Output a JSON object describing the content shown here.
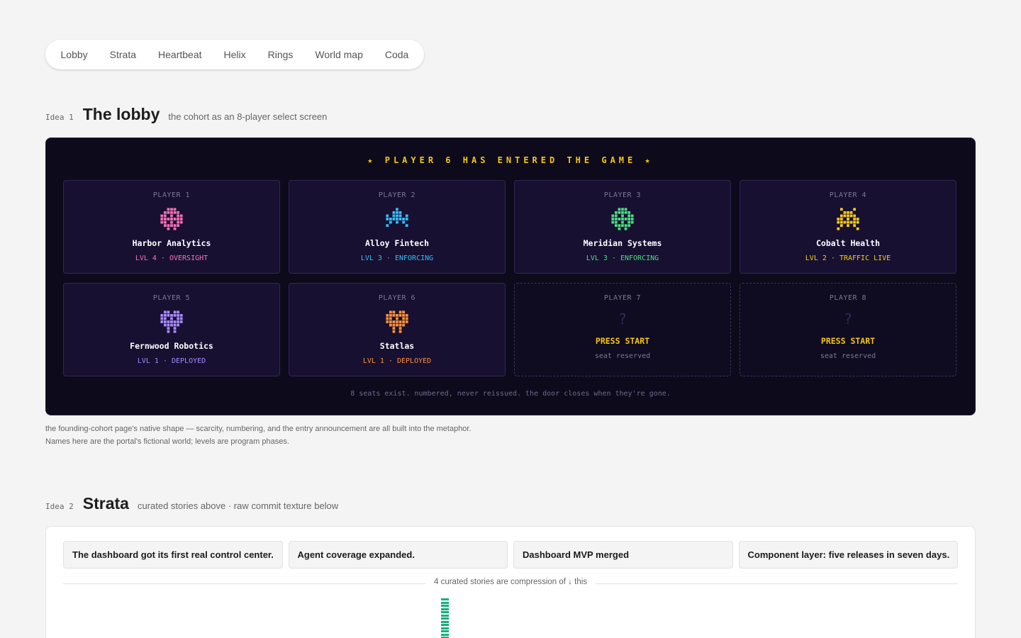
{
  "nav": {
    "tabs": [
      "Lobby",
      "Strata",
      "Heartbeat",
      "Helix",
      "Rings",
      "World map",
      "Coda"
    ]
  },
  "idea1": {
    "tag": "Idea 1",
    "title": "The lobby",
    "subtitle": "the cohort as an 8-player select screen",
    "banner": "★ PLAYER 6 HAS ENTERED THE GAME ★",
    "players": [
      {
        "player": "PLAYER 1",
        "name": "Harbor Analytics",
        "level": "LVL 4 · OVERSIGHT",
        "color": "#f472b6",
        "sprite": "hollow-gem-sprite"
      },
      {
        "player": "PLAYER 2",
        "name": "Alloy Fintech",
        "level": "LVL 3 · ENFORCING",
        "color": "#38bdf8",
        "sprite": "rocket-sprite"
      },
      {
        "player": "PLAYER 3",
        "name": "Meridian Systems",
        "level": "LVL 3 · ENFORCING",
        "color": "#4ade80",
        "sprite": "hollow-gem-sprite"
      },
      {
        "player": "PLAYER 4",
        "name": "Cobalt Health",
        "level": "LVL 2 · TRAFFIC LIVE",
        "color": "#facc15",
        "sprite": "invader-sprite"
      },
      {
        "player": "PLAYER 5",
        "name": "Fernwood Robotics",
        "level": "LVL 1 · DEPLOYED",
        "color": "#a78bfa",
        "sprite": "heart-sprite"
      },
      {
        "player": "PLAYER 6",
        "name": "Statlas",
        "level": "LVL 1 · DEPLOYED",
        "color": "#fb923c",
        "sprite": "heart-sprite"
      }
    ],
    "empty_slots": [
      {
        "player": "PLAYER 7",
        "mark": "?",
        "cta": "PRESS START",
        "note": "seat reserved"
      },
      {
        "player": "PLAYER 8",
        "mark": "?",
        "cta": "PRESS START",
        "note": "seat reserved"
      }
    ],
    "footer": "8 seats exist. numbered, never reissued. the door closes when they're gone.",
    "caption": "the founding-cohort page's native shape — scarcity, numbering, and the entry announcement are all built into the metaphor. Names here are the portal's fictional world; levels are program phases."
  },
  "idea2": {
    "tag": "Idea 2",
    "title": "Strata",
    "subtitle": "curated stories above · raw commit texture below",
    "stories": [
      "The dashboard got its first real control center.",
      "Agent coverage expanded.",
      "Dashboard MVP merged",
      "Component layer: five releases in seven days."
    ],
    "divider_label": "4 curated stories are compression of ↓ this",
    "commit_color": "#17b07c"
  }
}
